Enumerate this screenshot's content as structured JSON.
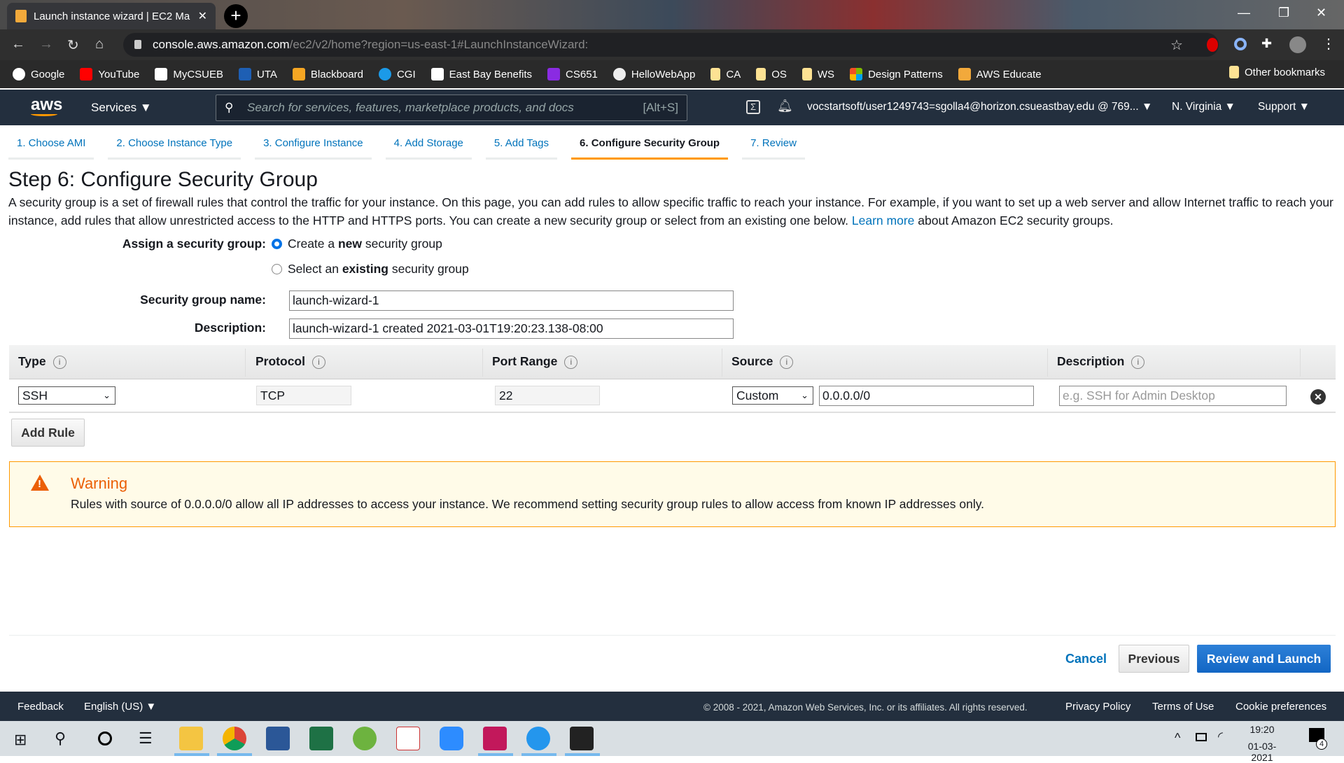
{
  "browser": {
    "tab_title": "Launch instance wizard | EC2 Ma",
    "url_host": "console.aws.amazon.com",
    "url_path": "/ec2/v2/home?region=us-east-1#LaunchInstanceWizard:",
    "bookmarks": [
      "Google",
      "YouTube",
      "MyCSUEB",
      "UTA",
      "Blackboard",
      "CGI",
      "East Bay Benefits",
      "CS651",
      "HelloWebApp",
      "CA",
      "OS",
      "WS",
      "Design Patterns",
      "AWS Educate"
    ],
    "other_bookmarks": "Other bookmarks"
  },
  "aws_nav": {
    "logo": "aws",
    "services": "Services ▼",
    "search_placeholder": "Search for services, features, marketplace products, and docs",
    "search_shortcut": "[Alt+S]",
    "account": "vocstartsoft/user1249743=sgolla4@horizon.csueastbay.edu @ 769... ▼",
    "region": "N. Virginia ▼",
    "support": "Support ▼"
  },
  "wizard_tabs": [
    "1. Choose AMI",
    "2. Choose Instance Type",
    "3. Configure Instance",
    "4. Add Storage",
    "5. Add Tags",
    "6. Configure Security Group",
    "7. Review"
  ],
  "page": {
    "title": "Step 6: Configure Security Group",
    "intro_before_link": "A security group is a set of firewall rules that control the traffic for your instance. On this page, you can add rules to allow specific traffic to reach your instance. For example, if you want to set up a web server and allow Internet traffic to reach your instance, add rules that allow unrestricted access to the HTTP and HTTPS ports. You can create a new security group or select from an existing one below.",
    "learn_more": "Learn more",
    "intro_after_link": "about Amazon EC2 security groups.",
    "assign_label": "Assign a security group:",
    "opt_new_pre": "Create a ",
    "opt_new_bold": "new",
    "opt_new_post": " security group",
    "opt_existing_pre": "Select an ",
    "opt_existing_bold": "existing",
    "opt_existing_post": " security group",
    "sg_name_label": "Security group name:",
    "sg_name_value": "launch-wizard-1",
    "desc_label": "Description:",
    "desc_value": "launch-wizard-1 created 2021-03-01T19:20:23.138-08:00"
  },
  "rules": {
    "headers": [
      "Type",
      "Protocol",
      "Port Range",
      "Source",
      "Description"
    ],
    "row": {
      "type": "SSH",
      "protocol": "TCP",
      "port": "22",
      "source_type": "Custom",
      "source": "0.0.0.0/0",
      "description_placeholder": "e.g. SSH for Admin Desktop"
    },
    "add_rule": "Add Rule"
  },
  "warning": {
    "title": "Warning",
    "text": "Rules with source of 0.0.0.0/0 allow all IP addresses to access your instance. We recommend setting security group rules to allow access from known IP addresses only."
  },
  "actions": {
    "cancel": "Cancel",
    "previous": "Previous",
    "review": "Review and Launch"
  },
  "footer": {
    "feedback": "Feedback",
    "language": "English (US) ▼",
    "copyright": "© 2008 - 2021, Amazon Web Services, Inc. or its affiliates. All rights reserved.",
    "privacy": "Privacy Policy",
    "terms": "Terms of Use",
    "cookies": "Cookie preferences"
  },
  "taskbar": {
    "time": "19:20",
    "date": "01-03-2021",
    "notifications": "4"
  }
}
